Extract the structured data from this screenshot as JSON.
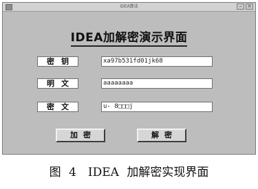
{
  "window": {
    "title": "IDEA算法",
    "minimize_glyph": "–",
    "close_glyph": "×"
  },
  "heading": "IDEA加解密演示界面",
  "fields": [
    {
      "label": "密钥",
      "value": "xa97b531fd01jk68"
    },
    {
      "label": "明文",
      "value": "aaaaaaaa"
    },
    {
      "label": "密文",
      "value": "u- 8□□□j"
    }
  ],
  "buttons": {
    "encrypt": "加密",
    "decrypt": "解密"
  },
  "caption": "图 4　IDEA 加解密实现界面"
}
